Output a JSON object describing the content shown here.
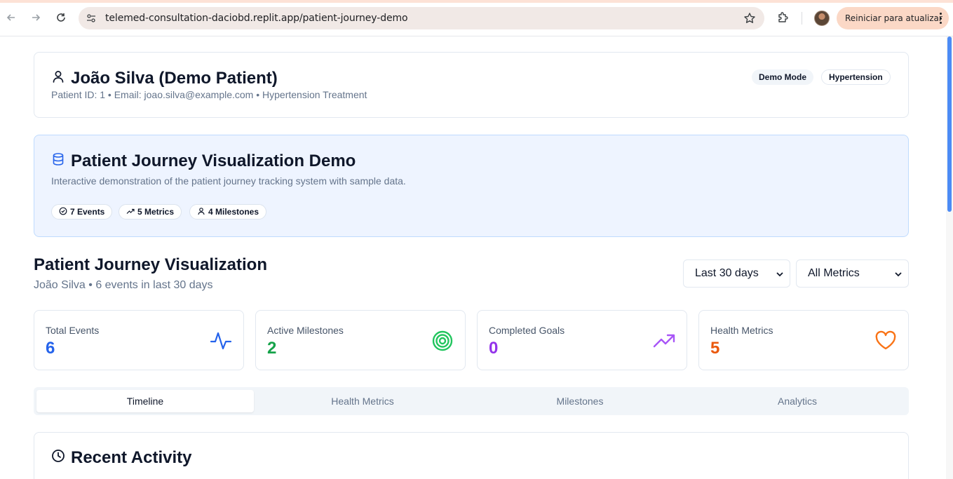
{
  "browser": {
    "url": "telemed-consultation-daciobd.replit.app/patient-journey-demo",
    "update_button": "Reiniciar para atualizar",
    "icons": [
      "back-icon",
      "forward-icon",
      "reload-icon",
      "site-settings-icon",
      "star-icon",
      "extensions-icon",
      "kebab-menu-icon"
    ]
  },
  "patient": {
    "name": "João Silva (Demo Patient)",
    "subtitle": "Patient ID: 1 • Email: joao.silva@example.com • Hypertension Treatment",
    "badges": [
      "Demo Mode",
      "Hypertension"
    ]
  },
  "demo": {
    "title": "Patient Journey Visualization Demo",
    "description": "Interactive demonstration of the patient journey tracking system with sample data.",
    "pills": [
      "7 Events",
      "5 Metrics",
      "4 Milestones"
    ]
  },
  "journey": {
    "title": "Patient Journey Visualization",
    "subtitle": "João Silva • 6 events in last 30 days",
    "period_select": "Last 30 days",
    "metric_select": "All Metrics"
  },
  "stats": [
    {
      "label": "Total Events",
      "value": "6",
      "color": "#2563eb",
      "icon": "activity-icon"
    },
    {
      "label": "Active Milestones",
      "value": "2",
      "color": "#16a34a",
      "icon": "target-icon"
    },
    {
      "label": "Completed Goals",
      "value": "0",
      "color": "#9333ea",
      "icon": "trending-up-icon"
    },
    {
      "label": "Health Metrics",
      "value": "5",
      "color": "#ea580c",
      "icon": "heart-icon"
    }
  ],
  "tabs": [
    "Timeline",
    "Health Metrics",
    "Milestones",
    "Analytics"
  ],
  "activity": {
    "title": "Recent Activity"
  }
}
